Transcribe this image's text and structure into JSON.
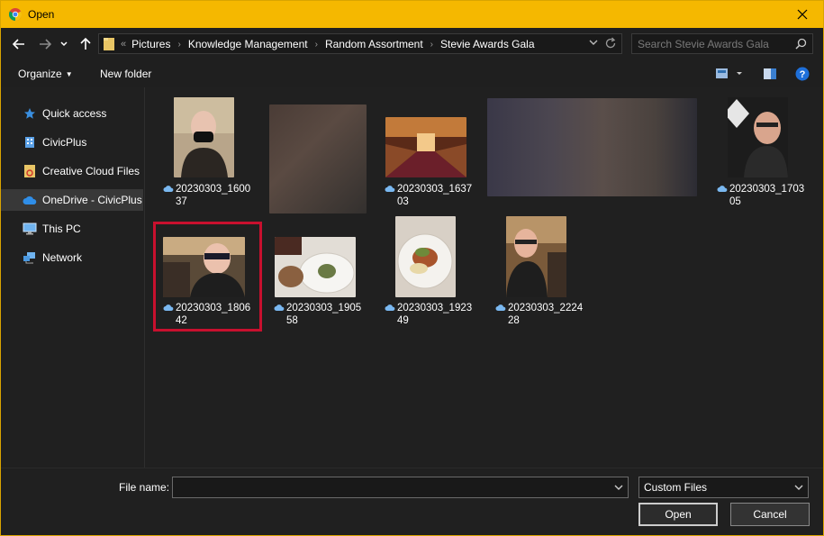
{
  "window": {
    "title": "Open",
    "accent": "#f5b800"
  },
  "address": {
    "overflow": "«",
    "crumbs": [
      "Pictures",
      "Knowledge Management",
      "Random Assortment",
      "Stevie Awards Gala"
    ]
  },
  "search": {
    "placeholder": "Search Stevie Awards Gala"
  },
  "toolbar": {
    "organize": "Organize",
    "new_folder": "New folder"
  },
  "nav": [
    {
      "label": "Quick access",
      "icon": "star-icon"
    },
    {
      "label": "CivicPlus",
      "icon": "building-icon"
    },
    {
      "label": "Creative Cloud Files",
      "icon": "creative-cloud-folder-icon"
    },
    {
      "label": "OneDrive - CivicPlus",
      "icon": "onedrive-cloud-icon",
      "selected": true
    },
    {
      "label": "This PC",
      "icon": "computer-icon"
    },
    {
      "label": "Network",
      "icon": "network-icon"
    }
  ],
  "files": [
    {
      "line1": "20230303_1600",
      "line2": "37"
    },
    {
      "line1": "20230303_1637",
      "line2": "03"
    },
    {
      "line1": "20230303_1703",
      "line2": "05"
    },
    {
      "line1": "20230303_1806",
      "line2": "42",
      "selected": true
    },
    {
      "line1": "20230303_1905",
      "line2": "58"
    },
    {
      "line1": "20230303_1923",
      "line2": "49"
    },
    {
      "line1": "20230303_2224",
      "line2": "28"
    }
  ],
  "bottom": {
    "file_name_label": "File name:",
    "file_name_value": "",
    "file_type": "Custom Files",
    "open": "Open",
    "cancel": "Cancel"
  },
  "colors": {
    "background": "#202020",
    "selection_border": "#c8102e",
    "titlebar": "#f5b800"
  }
}
